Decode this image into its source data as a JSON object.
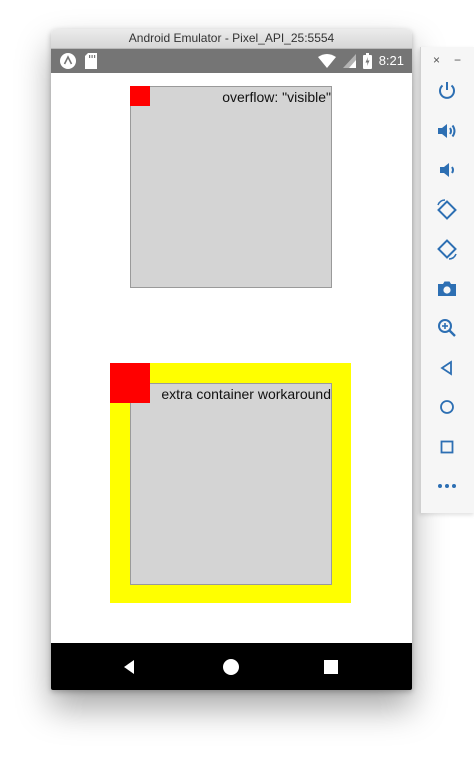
{
  "window": {
    "title": "Android Emulator - Pixel_API_25:5554"
  },
  "status_bar": {
    "time": "8:21",
    "left_icons": [
      "android-icon",
      "sd-card-icon"
    ],
    "right_icons": [
      "wifi-icon",
      "signal-icon",
      "battery-icon"
    ]
  },
  "screen": {
    "demo1": {
      "label": "overflow: \"visible\""
    },
    "demo2": {
      "label": "extra container workaround"
    }
  },
  "colors": {
    "gray_box": "#d4d4d4",
    "red": "#ff0000",
    "yellow": "#ffff00",
    "status_bar": "#757575",
    "nav_bar": "#000000",
    "tool_icon": "#2d6fb3"
  },
  "nav_bar": {
    "buttons": [
      "back-icon",
      "home-icon",
      "recents-icon"
    ]
  },
  "side_toolbar": {
    "close_label": "×",
    "minimize_label": "−",
    "tools": [
      "power-icon",
      "volume-up-icon",
      "volume-down-icon",
      "rotate-left-icon",
      "rotate-right-icon",
      "camera-icon",
      "zoom-icon",
      "back-icon",
      "home-icon",
      "overview-icon",
      "more-icon"
    ]
  }
}
